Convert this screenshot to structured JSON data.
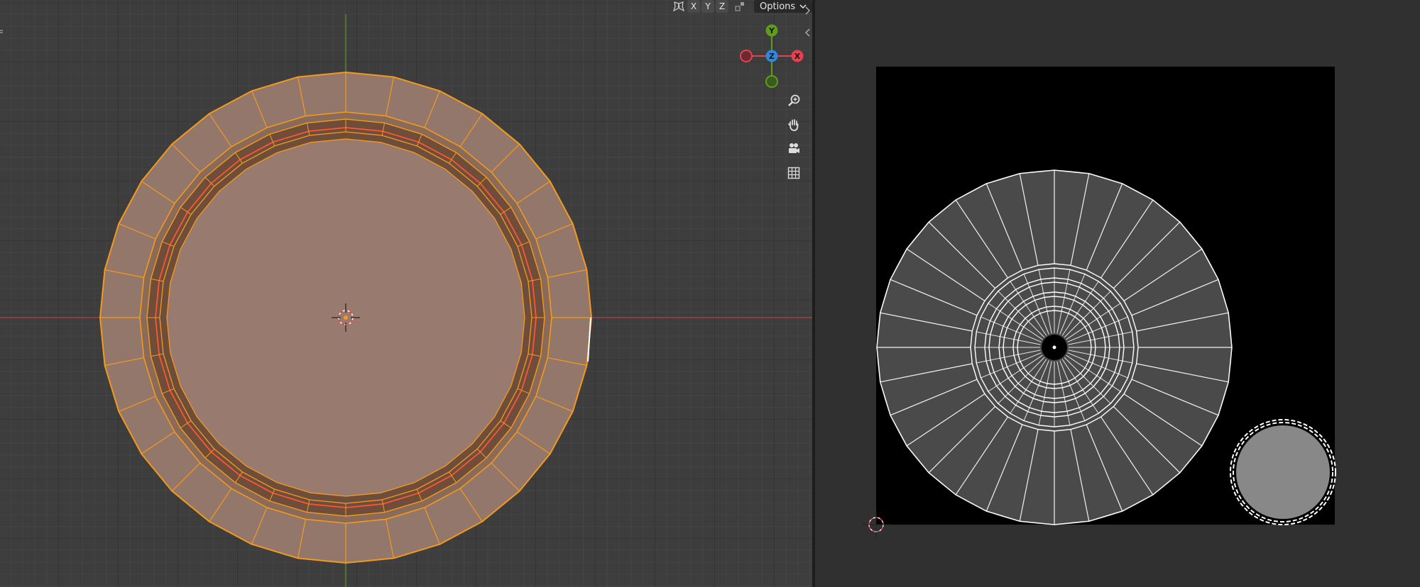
{
  "viewport": {
    "header": {
      "axis_x": "X",
      "axis_y": "Y",
      "axis_z": "Z",
      "options_label": "Options",
      "options_chevron": "chevron-down-icon",
      "mirror_icon": "butterfly-mirror-icon",
      "snap_icon": "snap-icon"
    },
    "gizmo": {
      "x": "X",
      "y": "Y",
      "z": "Z",
      "colors": {
        "x": "#e8404f",
        "y": "#5f9c1a",
        "z": "#2f87e0"
      }
    },
    "nav_icons": [
      "zoom-icon",
      "hand-pan-icon",
      "camera-icon",
      "grid-icon"
    ]
  },
  "colors": {
    "selection_orange": "#f39a1e",
    "face_fill": "#987a6e",
    "edge_red": "#ff5533",
    "uv_background": "#000000",
    "uv_face": "#4a4a4a",
    "uv_island_small": "#888888",
    "grid_bg": "#3d3d3d"
  }
}
